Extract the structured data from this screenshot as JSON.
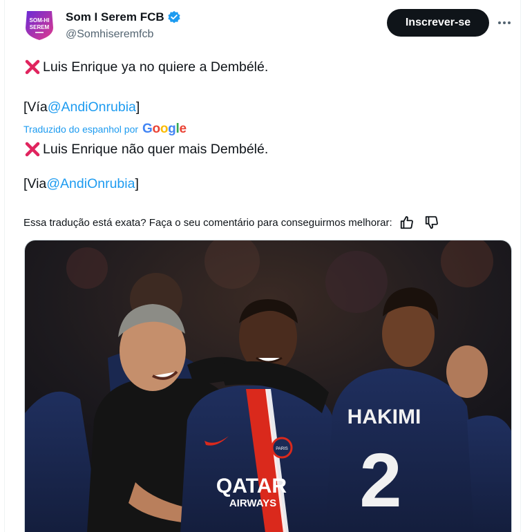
{
  "tweet": {
    "avatar_icon": "som-hi-serem-logo",
    "avatar_text_1": "SOM-HI",
    "avatar_text_2": "SEREM",
    "display_name": "Som I Serem FCB",
    "verified_icon": "verified-badge-icon",
    "handle": "@Somhiseremfcb",
    "follow_label": "Inscrever-se",
    "more_icon": "more-options-icon",
    "original": {
      "line1": "Luis Enrique ya no quiere a Dembélé.",
      "line2_prefix": "[Vía ",
      "line2_mention": "@AndiOnrubia",
      "line2_suffix": " ]"
    },
    "translation_label": "Traduzido do espanhol por",
    "translation_provider": "Google",
    "translated": {
      "line1": " Luis Enrique não quer mais Dembélé.",
      "line2_prefix": "[Via ",
      "line2_mention": "@AndiOnrubia",
      "line2_suffix": " ]"
    },
    "feedback_prompt": "Essa tradução está exata? Faça o seu comentário para conseguirmos melhorar:",
    "media": {
      "jersey_text_1": "QATAR",
      "jersey_text_2": "AIRWAYS",
      "back_name": "HAKIMI",
      "back_number": "2",
      "crest_text": "PARIS"
    }
  },
  "colors": {
    "accent": "#1d9bf0",
    "follow_bg": "#0f1419",
    "x_mark": "#e0245e",
    "psg_navy": "#1b2a55",
    "psg_red": "#da291c"
  }
}
